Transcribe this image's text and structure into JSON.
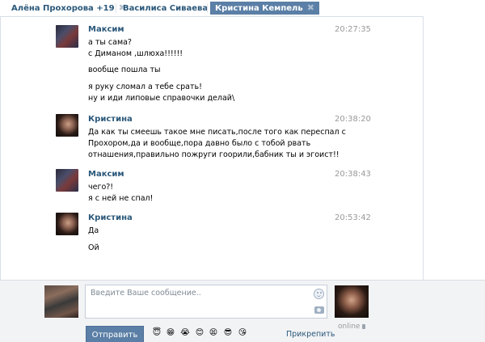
{
  "tabs": [
    {
      "label": "Алёна Прохорова +19",
      "close": "✖",
      "active": false
    },
    {
      "label": "Василиса Сиваева",
      "close": "✖",
      "active": false
    },
    {
      "label": "Кристина Кемпель",
      "close": "✖",
      "active": true
    }
  ],
  "messages": [
    {
      "author": "Максим",
      "time": "20:27:35",
      "lines": [
        "а ты сама?",
        "с Диманом ,шлюха!!!!!!",
        "вообще пошла ты",
        "я руку сломал а тебе срать!",
        "ну и иди липовые справочки делай\\"
      ]
    },
    {
      "author": "Кристина",
      "time": "20:38:20",
      "lines": [
        "Да как ты смеешь такое мне писать,после того как переспал с",
        "Прохором,да и вообще,пора давно было с тобой рвать",
        "отнашения,правильно пожруги гоорили,бабник ты и эгоист!!"
      ]
    },
    {
      "author": "Максим",
      "time": "20:38:43",
      "lines": [
        "чего?!",
        "я с ней не спал!"
      ]
    },
    {
      "author": "Кристина",
      "time": "20:53:42",
      "lines": [
        "Да",
        "Ой"
      ]
    }
  ],
  "composer": {
    "placeholder": "Введите Ваше сообщение..",
    "send_label": "Отправить",
    "attach_label": "Прикрепить",
    "online_label": "online",
    "emojis": [
      "😇",
      "😁",
      "😭",
      "😊",
      "😫",
      "😎",
      "😘"
    ]
  },
  "colors": {
    "accent": "#5b7fa6",
    "link": "#2b587a",
    "time": "#999999"
  }
}
